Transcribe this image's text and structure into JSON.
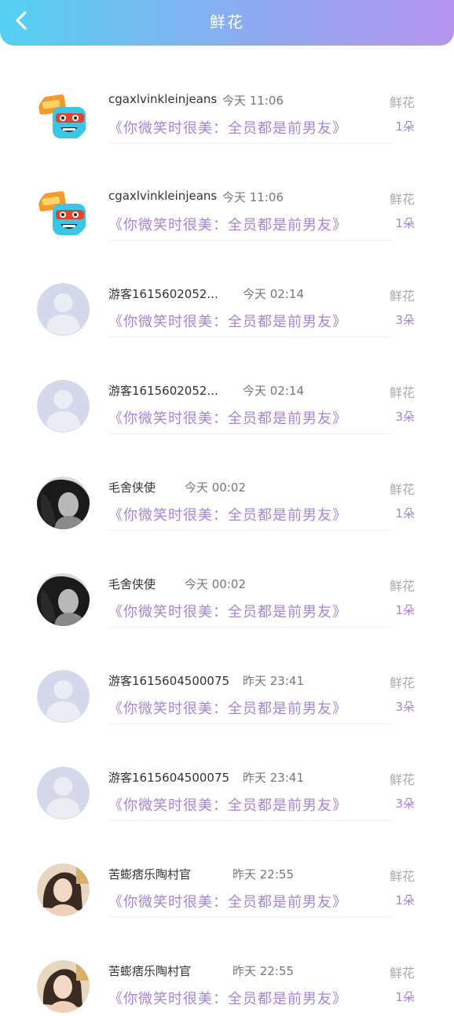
{
  "header": {
    "title": "鲜花",
    "back_icon": "chevron-left-icon"
  },
  "colors": {
    "accent_purple": "#a684d6",
    "header_start": "#53d1f2",
    "header_end": "#b595ee"
  },
  "records": [
    {
      "user": "cgaxlvinkleinjeans",
      "time": "今天 11:06",
      "book": "《你微笑时很美：全员都是前男友》",
      "gift": "鲜花",
      "count": "1朵",
      "avatar": "cartoon-avatar"
    },
    {
      "user": "cgaxlvinkleinjeans",
      "time": "今天 11:06",
      "book": "《你微笑时很美：全员都是前男友》",
      "gift": "鲜花",
      "count": "1朵",
      "avatar": "cartoon-avatar"
    },
    {
      "user": "游客1615602052...",
      "time": "今天 02:14",
      "book": "《你微笑时很美：全员都是前男友》",
      "gift": "鲜花",
      "count": "3朵",
      "avatar": "default-avatar"
    },
    {
      "user": "游客1615602052...",
      "time": "今天 02:14",
      "book": "《你微笑时很美：全员都是前男友》",
      "gift": "鲜花",
      "count": "3朵",
      "avatar": "default-avatar"
    },
    {
      "user": "毛舍侠使",
      "time": "今天 00:02",
      "book": "《你微笑时很美：全员都是前男友》",
      "gift": "鲜花",
      "count": "1朵",
      "avatar": "photo-avatar-dark"
    },
    {
      "user": "毛舍侠使",
      "time": "今天 00:02",
      "book": "《你微笑时很美：全员都是前男友》",
      "gift": "鲜花",
      "count": "1朵",
      "avatar": "photo-avatar-dark"
    },
    {
      "user": "游客1615604500075",
      "time": "昨天 23:41",
      "book": "《你微笑时很美：全员都是前男友》",
      "gift": "鲜花",
      "count": "3朵",
      "avatar": "default-avatar"
    },
    {
      "user": "游客1615604500075",
      "time": "昨天 23:41",
      "book": "《你微笑时很美：全员都是前男友》",
      "gift": "鲜花",
      "count": "3朵",
      "avatar": "default-avatar"
    },
    {
      "user": "苦蟛痞乐陶村官",
      "time": "昨天 22:55",
      "book": "《你微笑时很美：全员都是前男友》",
      "gift": "鲜花",
      "count": "1朵",
      "avatar": "photo-avatar-girl"
    },
    {
      "user": "苦蟛痞乐陶村官",
      "time": "昨天 22:55",
      "book": "《你微笑时很美：全员都是前男友》",
      "gift": "鲜花",
      "count": "1朵",
      "avatar": "photo-avatar-girl"
    }
  ]
}
